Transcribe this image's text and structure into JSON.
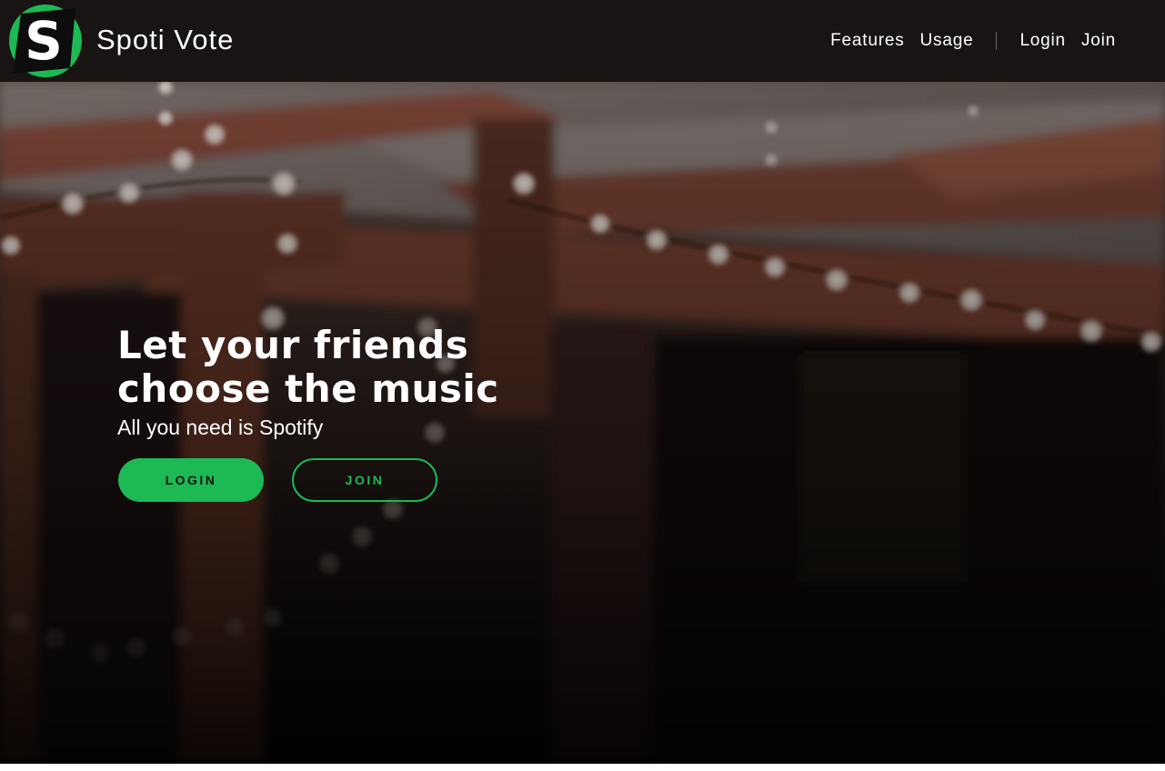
{
  "navbar": {
    "brand": "Spoti Vote",
    "logo_icon": "spotivote-s-logo-icon",
    "links": [
      {
        "label": "Features"
      },
      {
        "label": "Usage"
      }
    ],
    "auth_links": [
      {
        "label": "Login"
      },
      {
        "label": "Join"
      }
    ]
  },
  "hero": {
    "title_line1": "Let your friends",
    "title_line2": "choose the music",
    "subtitle": "All you need is Spotify",
    "login_button": "LOGIN",
    "join_button": "JOIN"
  },
  "colors": {
    "accent": "#1db954",
    "navbar_bg": "#191414",
    "text": "#ffffff"
  }
}
